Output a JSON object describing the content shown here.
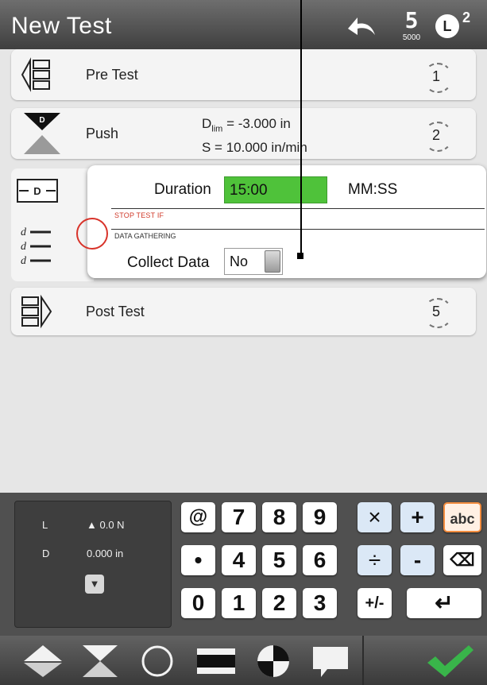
{
  "title": "New Test",
  "header": {
    "frame_number": "5",
    "frame_sub": "5000",
    "load_letter": "L",
    "load_sup": "2"
  },
  "steps": [
    {
      "label": "Pre Test",
      "number": "1"
    },
    {
      "label": "Push",
      "number": "2",
      "detail_line1_prefix": "D",
      "detail_line1_sub": "lim",
      "detail_line1_rest": " = -3.000 in",
      "detail_line2": "S = 10.000 in/min"
    },
    {
      "label": "Post Test",
      "number": "5"
    }
  ],
  "stop_dialog": {
    "duration_label": "Duration",
    "duration_value": "15:00",
    "duration_unit": "MM:SS",
    "stop_header": "STOP TEST IF",
    "data_header": "DATA GATHERING",
    "collect_label": "Collect Data",
    "collect_value": "No"
  },
  "readout": {
    "l_key": "L",
    "l_value": "0.0 N",
    "d_key": "D",
    "d_value": "0.000 in"
  },
  "keypad": {
    "row1": [
      "@",
      "7",
      "8",
      "9",
      "×",
      "+",
      "abc"
    ],
    "row2": [
      "•",
      "4",
      "5",
      "6",
      "÷",
      "-",
      "⌫"
    ],
    "row3": [
      "0",
      "1",
      "2",
      "3",
      "+/-",
      "↵"
    ]
  },
  "colors": {
    "accent_green": "#4fc23a",
    "stop_red": "#d03a2a",
    "confirm_green": "#39b54a",
    "abc_orange": "#f28c3e"
  }
}
